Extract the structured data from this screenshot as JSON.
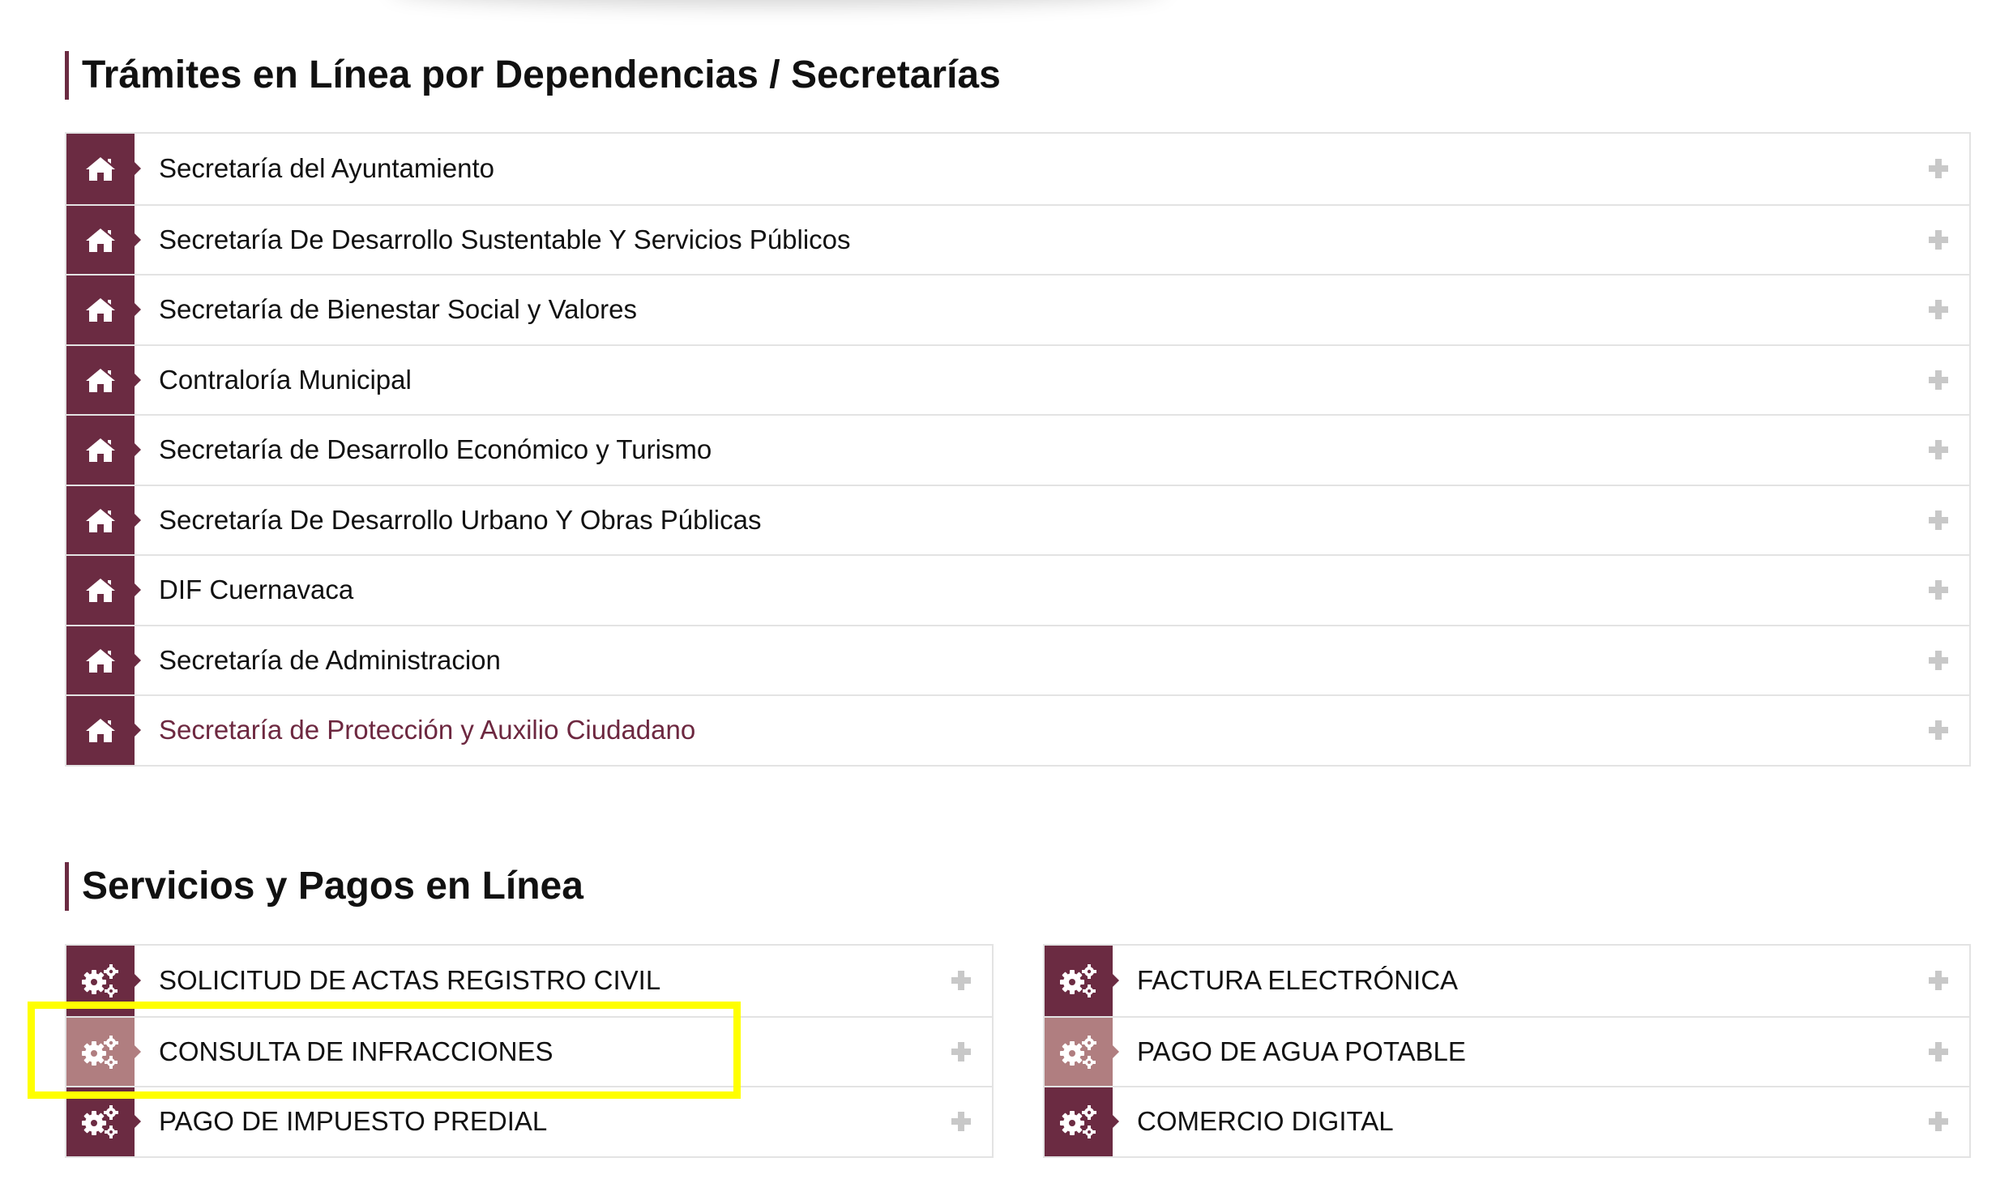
{
  "colors": {
    "accent": "#6b2b42",
    "accent_light": "#b07e80",
    "active_text": "#6d2840",
    "highlight": "#ffff00"
  },
  "tramites": {
    "title": "Trámites en Línea por Dependencias / Secretarías",
    "items": [
      {
        "label": "Secretaría del Ayuntamiento",
        "icon": "home-icon"
      },
      {
        "label": "Secretaría De Desarrollo Sustentable Y Servicios Públicos",
        "icon": "home-icon"
      },
      {
        "label": "Secretaría de Bienestar Social y Valores",
        "icon": "home-icon"
      },
      {
        "label": "Contraloría Municipal",
        "icon": "home-icon"
      },
      {
        "label": "Secretaría de Desarrollo Económico y Turismo",
        "icon": "home-icon"
      },
      {
        "label": "Secretaría De Desarrollo Urbano Y Obras Públicas",
        "icon": "home-icon"
      },
      {
        "label": "DIF Cuernavaca",
        "icon": "home-icon"
      },
      {
        "label": "Secretaría de Administracion",
        "icon": "home-icon"
      },
      {
        "label": "Secretaría de Protección y Auxilio Ciudadano",
        "icon": "home-icon"
      }
    ]
  },
  "servicios": {
    "title": "Servicios y Pagos en Línea",
    "left": [
      {
        "label": "SOLICITUD DE ACTAS REGISTRO CIVIL",
        "icon": "gears-icon"
      },
      {
        "label": "CONSULTA DE INFRACCIONES",
        "icon": "gears-icon"
      },
      {
        "label": "PAGO DE IMPUESTO PREDIAL",
        "icon": "gears-icon"
      }
    ],
    "right": [
      {
        "label": "FACTURA ELECTRÓNICA",
        "icon": "gears-icon"
      },
      {
        "label": "PAGO DE AGUA POTABLE",
        "icon": "gears-icon"
      },
      {
        "label": "COMERCIO DIGITAL",
        "icon": "gears-icon"
      }
    ]
  }
}
